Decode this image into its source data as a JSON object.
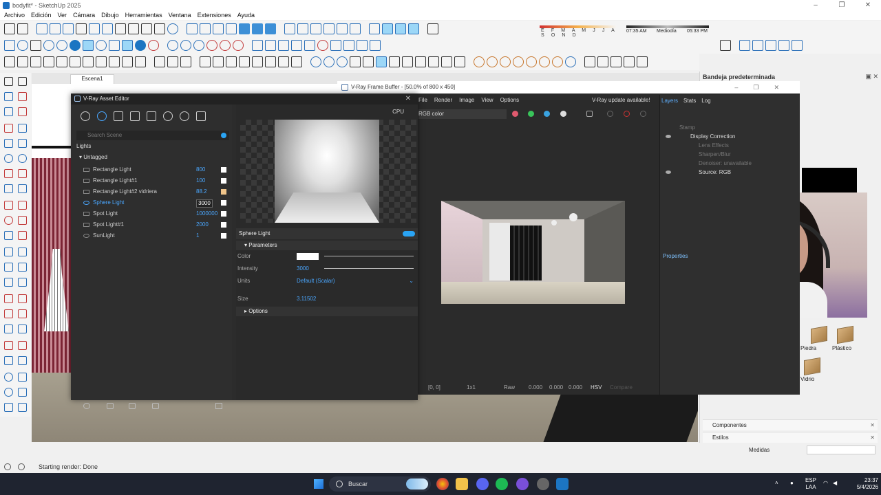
{
  "app": {
    "title": "bodyfit* - SketchUp 2025",
    "menu": [
      "Archivo",
      "Edición",
      "Ver",
      "Cámara",
      "Dibujo",
      "Herramientas",
      "Ventana",
      "Extensiones",
      "Ayuda"
    ]
  },
  "shadows": {
    "months": "E F M A M J J A S O N D",
    "time_start": "07:35 AM",
    "time_mid": "Mediodía",
    "time_end": "05:33 PM"
  },
  "scene_tab": "Escena1",
  "tray": {
    "title": "Bandeja predeterminada",
    "rows": [
      {
        "label": "Componentes"
      },
      {
        "label": "Estilos"
      }
    ],
    "materials": [
      {
        "label": "Piedra"
      },
      {
        "label": "Plástico"
      },
      {
        "label": "Vidrio"
      }
    ],
    "measurements_label": "Medidas"
  },
  "status_text": "Starting render: Done",
  "taskbar": {
    "search_placeholder": "Buscar",
    "lang_top": "ESP",
    "lang_bottom": "LAA",
    "time": "23:37",
    "date": "5/4/2026"
  },
  "vfb": {
    "title": "V-Ray Frame Buffer - [50.0% of 800 x 450]",
    "menu": [
      "File",
      "Render",
      "Image",
      "View",
      "Options"
    ],
    "update_notice": "V-Ray update available!",
    "channel": "RGB color",
    "bottom": {
      "coords": "[0, 0]",
      "zoom": "1x1",
      "raw": "Raw",
      "v1": "0.000",
      "v2": "0.000",
      "v3": "0.000",
      "hsv": "HSV",
      "mode": "Compare"
    },
    "side_tabs": [
      "Layers",
      "Stats",
      "Log"
    ],
    "layers": [
      {
        "label": "Stamp"
      },
      {
        "label": "Display Correction"
      },
      {
        "label": "Lens Effects"
      },
      {
        "label": "Sharpen/Blur"
      },
      {
        "label": "Denoiser: unavailable"
      },
      {
        "label": "Source: RGB"
      }
    ],
    "properties_label": "Properties"
  },
  "vae": {
    "title": "V-Ray Asset Editor",
    "search_placeholder": "Search Scene",
    "section": "Lights",
    "group": "Untagged",
    "lights": [
      {
        "name": "Rectangle Light",
        "value": "800",
        "color": "#ffffff"
      },
      {
        "name": "Rectangle Light#1",
        "value": "100",
        "color": "#ffffff"
      },
      {
        "name": "Rectangle Light#2 vidriera",
        "value": "88.2",
        "color": "#f0c48a"
      },
      {
        "name": "Sphere Light",
        "value": "3000",
        "color": "#ffffff"
      },
      {
        "name": "Spot Light",
        "value": "1000000",
        "color": "#ffffff"
      },
      {
        "name": "Spot Light#1",
        "value": "2000",
        "color": "#ffffff"
      },
      {
        "name": "SunLight",
        "value": "1",
        "color": "#ffffff"
      }
    ],
    "render_device": "CPU",
    "selected_light": "Sphere Light",
    "parameters_label": "Parameters",
    "params": {
      "color_label": "Color",
      "intensity_label": "Intensity",
      "intensity_value": "3000",
      "units_label": "Units",
      "units_value": "Default (Scalar)",
      "size_label": "Size",
      "size_value": "3.11502"
    },
    "options_label": "Options"
  }
}
